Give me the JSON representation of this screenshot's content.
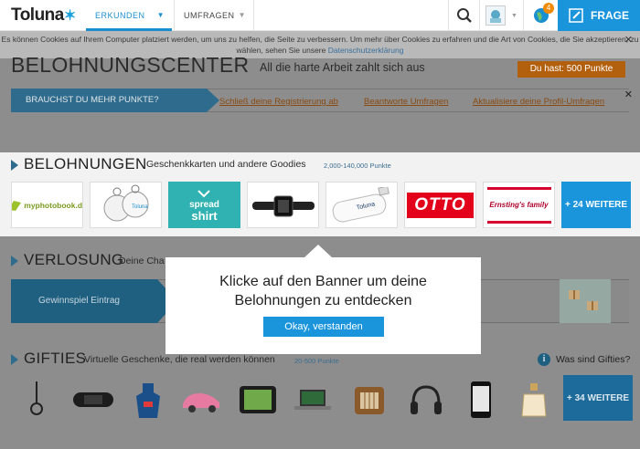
{
  "nav": {
    "logo": "Toluna",
    "tabs": [
      {
        "label": "ERKUNDEN"
      },
      {
        "label": "UMFRAGEN"
      }
    ],
    "notification_count": "4",
    "ask_button": "FRAGE"
  },
  "cookie": {
    "text": "Es können Cookies auf Ihrem Computer platziert werden, um uns zu helfen, die Seite zu verbessern. Um mehr über Cookies zu erfahren und die Art von Cookies, die Sie akzeptieren, zu wählen, sehen Sie unsere",
    "link": "Datenschutzerklärung"
  },
  "header": {
    "title": "BELOHNUNGSCENTER",
    "subtitle": "All die harte Arbeit zahlt sich aus",
    "points": "Du hast: 500 Punkte"
  },
  "need_points": {
    "label": "BRAUCHST DU MEHR PUNKTE?",
    "links": [
      "Schließ deine Registrierung ab",
      "Beantworte Umfragen",
      "Aktualisiere deine Profil-Umfragen"
    ]
  },
  "rewards": {
    "title": "BELOHNUNGEN",
    "subtitle": "Geschenkkarten und andere Goodies",
    "range": "2,000-140,000 Punkte",
    "tiles": [
      {
        "name": "myphotobook.de"
      },
      {
        "name": "Toluna Kofferanhänger"
      },
      {
        "name": "spreadshirt"
      },
      {
        "name": "Armband-Halterung"
      },
      {
        "name": "Toluna USB-Stick"
      },
      {
        "name": "OTTO"
      },
      {
        "name": "Ernsting's family"
      }
    ],
    "tile_text": {
      "myphotobook": "myphotobook.de",
      "spread": "spread",
      "shirt": "shirt",
      "otto": "OTTO",
      "ernsting": "Ernsting's family"
    },
    "more": "+ 24 WEITERE"
  },
  "raffle": {
    "title": "VERLOSUNG",
    "subtitle": "Deine Cha",
    "entry": "Gewinnspiel Eintrag"
  },
  "gifties": {
    "title": "GIFTIES",
    "subtitle": "Virtuelle Geschenke, die real werden können",
    "range": "20-500 Punkte",
    "what": "Was sind Gifties?",
    "more": "+ 34 WEITERE",
    "items": [
      "schlüsselanhänger-icon",
      "konsole-icon",
      "schürze-icon",
      "auto-icon",
      "tablet-icon",
      "laptop-icon",
      "radio-icon",
      "kopfhörer-icon",
      "smartphone-icon",
      "parfüm-icon"
    ]
  },
  "popup": {
    "line1": "Klicke auf den Banner um deine",
    "line2": "Belohnungen zu entdecken",
    "button": "Okay, verstanden"
  },
  "colors": {
    "accent": "#1a95dc",
    "orange": "#b25f0e",
    "otto": "#e2001a"
  }
}
